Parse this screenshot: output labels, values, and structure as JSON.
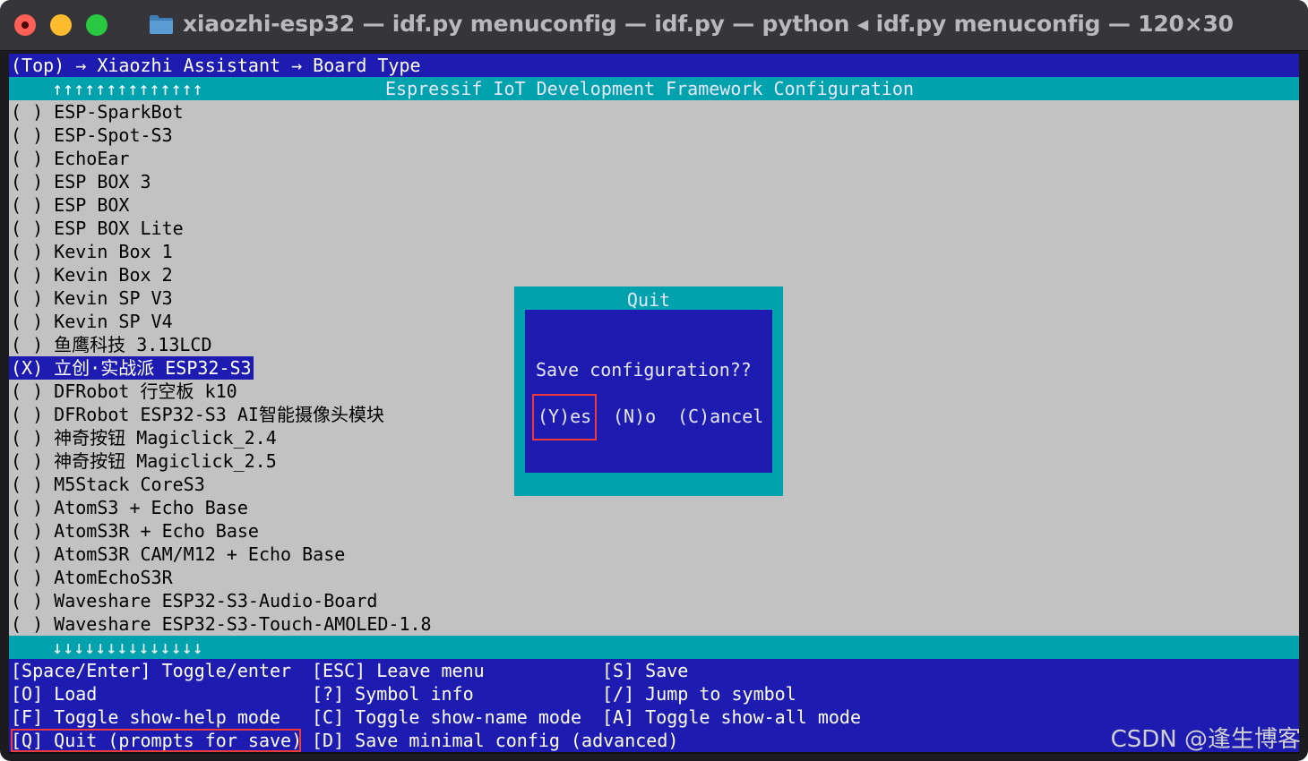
{
  "window": {
    "title": "xiaozhi-esp32 — idf.py menuconfig — idf.py — python ◂ idf.py menuconfig — 120×30",
    "folder_icon": "folder-icon",
    "colors": {
      "menu_blue": "#1e1cb0",
      "cyan": "#00a3ad",
      "list_gray": "#c2c2c2",
      "highlight_red": "#ee3a3a"
    }
  },
  "breadcrumb": "(Top) → Xiaozhi Assistant → Board Type",
  "header": {
    "up_arrows": "↑↑↑↑↑↑↑↑↑↑↑↑↑↑",
    "title": "Espressif IoT Development Framework Configuration"
  },
  "board_list": {
    "items": [
      "( ) ESP-SparkBot",
      "( ) ESP-Spot-S3",
      "( ) EchoEar",
      "( ) ESP BOX 3",
      "( ) ESP BOX",
      "( ) ESP BOX Lite",
      "( ) Kevin Box 1",
      "( ) Kevin Box 2",
      "( ) Kevin SP V3",
      "( ) Kevin SP V4",
      "( ) 鱼鹰科技 3.13LCD",
      "(X) 立创·实战派 ESP32-S3",
      "( ) DFRobot 行空板 k10",
      "( ) DFRobot ESP32-S3 AI智能摄像头模块",
      "( ) 神奇按钮 Magiclick_2.4",
      "( ) 神奇按钮 Magiclick_2.5",
      "( ) M5Stack CoreS3",
      "( ) AtomS3 + Echo Base",
      "( ) AtomS3R + Echo Base",
      "( ) AtomS3R CAM/M12 + Echo Base",
      "( ) AtomEchoS3R",
      "( ) Waveshare ESP32-S3-Audio-Board",
      "( ) Waveshare ESP32-S3-Touch-AMOLED-1.8"
    ],
    "selected_index": 11
  },
  "footer": {
    "down_arrows": "↓↓↓↓↓↓↓↓↓↓↓↓↓↓"
  },
  "help": {
    "space_enter": "[Space/Enter] Toggle/enter",
    "esc": "[ESC] Leave menu",
    "save": "[S] Save",
    "load": "[O] Load",
    "symbol_info": "[?] Symbol info",
    "jump": "[/] Jump to symbol",
    "show_help": "[F] Toggle show-help mode",
    "show_name": "[C] Toggle show-name mode",
    "show_all": "[A] Toggle show-all mode",
    "quit": "[Q] Quit (prompts for save)",
    "save_minimal": "[D] Save minimal config (advanced)"
  },
  "dialog": {
    "title": "Quit",
    "message": "Save configuration??",
    "yes": "(Y)es",
    "no": "(N)o",
    "cancel": "(C)ancel"
  },
  "watermark": "CSDN @逢生博客"
}
